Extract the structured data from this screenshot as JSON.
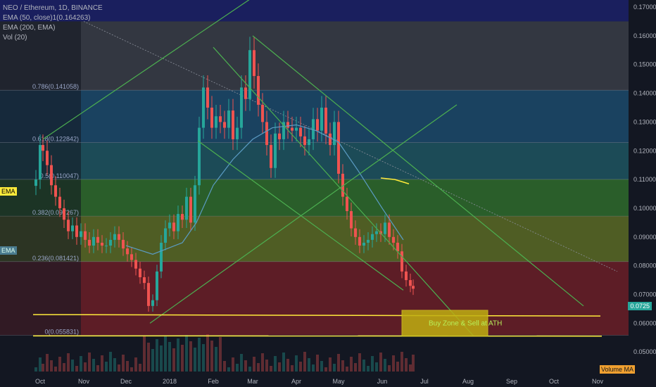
{
  "legend": {
    "symbol_line": "NEO / Ethereum, 1D, BINANCE",
    "ema50_line": "EMA (50, close)1(0.164263)",
    "ema200_line": "EMA (200, EMA)",
    "vol_line": "Vol (20)"
  },
  "left_badges": {
    "ema_yellow": "EMA",
    "ema_teal": "EMA"
  },
  "volume_ma_label": "Volume MA",
  "last_price_badge": "0.0725",
  "colors": {
    "background": "#131722",
    "up": "#26a69a",
    "down": "#ef5350",
    "channel": "#4caf50",
    "support": "#ffeb3b",
    "ema": "#5b9cc4",
    "buy_zone_fill": "#bfae12",
    "buy_zone_text": "#b8f05a",
    "fib_band_colors": [
      "#3a3d46",
      "#1c4a6b",
      "#1f5560",
      "#2f6b2c",
      "#5b6a24",
      "#6b1f27"
    ]
  },
  "chart_data": {
    "type": "candlestick",
    "title": "NEO / Ethereum, 1D, BINANCE",
    "x_tick_labels": [
      "Oct",
      "Nov",
      "Dec",
      "2018",
      "Feb",
      "Mar",
      "Apr",
      "May",
      "Jun",
      "Jul",
      "Aug",
      "Sep",
      "Oct",
      "Nov"
    ],
    "y_tick_labels": [
      "0.170000",
      "0.160000",
      "0.150000",
      "0.140000",
      "0.130000",
      "0.120000",
      "0.110000",
      "0.100000",
      "0.090000",
      "0.080000",
      "0.070000",
      "0.060000",
      "0.050000"
    ],
    "ylim": [
      0.05,
      0.17
    ],
    "fib_levels": [
      {
        "label": "0.786(0.141058)",
        "value": 0.141058
      },
      {
        "label": "0.618(0.122842)",
        "value": 0.122842
      },
      {
        "label": "0.5(0.110047)",
        "value": 0.110047
      },
      {
        "label": "0.382(0.097267)",
        "value": 0.097267
      },
      {
        "label": "0.236(0.081421)",
        "value": 0.081421
      },
      {
        "label": "0(0.055831)",
        "value": 0.055831
      }
    ],
    "fib_top": 0.165,
    "annotation": "Buy Zone & Sell at ATH",
    "buy_zone": {
      "from": "2018-06-15",
      "to": "2018-08-15",
      "low": 0.0555,
      "high": 0.0645
    },
    "support_lines": [
      {
        "from": "2017-10-01",
        "to": "2018-11-03",
        "value_start": 0.063,
        "value_end": 0.0625
      },
      {
        "from": "2017-10-01",
        "to": "2018-11-04",
        "value_start": 0.0556,
        "value_end": 0.0555
      }
    ],
    "trend_lines": [
      {
        "x1": "2017-10-03",
        "y1": 0.124,
        "x2": "2018-03-15",
        "y2": 0.178
      },
      {
        "x1": "2018-02-01",
        "y1": 0.156,
        "x2": "2018-08-05",
        "y2": 0.0555
      },
      {
        "x1": "2018-03-01",
        "y1": 0.16,
        "x2": "2018-10-22",
        "y2": 0.066
      },
      {
        "x1": "2018-01-21",
        "y1": 0.1235,
        "x2": "2018-06-16",
        "y2": 0.0715
      },
      {
        "x1": "2017-12-18",
        "y1": 0.06,
        "x2": "2018-07-24",
        "y2": 0.136
      }
    ],
    "dotted_line": {
      "x1": "2017-11-01",
      "y1": 0.165,
      "x2": "2018-11-15",
      "y2": 0.078
    },
    "yellow_curve": [
      [
        "2018-05-31",
        0.1105
      ],
      [
        "2018-06-10",
        0.11
      ],
      [
        "2018-06-20",
        0.1085
      ]
    ],
    "ema_curve": [
      [
        "2017-12-01",
        0.087
      ],
      [
        "2017-12-20",
        0.084
      ],
      [
        "2018-01-10",
        0.088
      ],
      [
        "2018-01-20",
        0.095
      ],
      [
        "2018-02-01",
        0.108
      ],
      [
        "2018-02-15",
        0.117
      ],
      [
        "2018-03-01",
        0.124
      ],
      [
        "2018-03-15",
        0.128
      ],
      [
        "2018-04-01",
        0.129
      ],
      [
        "2018-04-15",
        0.127
      ],
      [
        "2018-05-01",
        0.123
      ],
      [
        "2018-05-15",
        0.113
      ],
      [
        "2018-06-01",
        0.1
      ],
      [
        "2018-06-16",
        0.089
      ]
    ],
    "candles_close": [
      [
        "2017-09-28",
        0.11
      ],
      [
        "2017-10-01",
        0.122
      ],
      [
        "2017-10-03",
        0.12
      ],
      [
        "2017-10-06",
        0.115
      ],
      [
        "2017-10-09",
        0.108
      ],
      [
        "2017-10-12",
        0.104
      ],
      [
        "2017-10-15",
        0.1
      ],
      [
        "2017-10-18",
        0.096
      ],
      [
        "2017-10-21",
        0.092
      ],
      [
        "2017-10-24",
        0.094
      ],
      [
        "2017-10-27",
        0.09
      ],
      [
        "2017-10-30",
        0.092
      ],
      [
        "2017-11-02",
        0.089
      ],
      [
        "2017-11-05",
        0.087
      ],
      [
        "2017-11-08",
        0.09
      ],
      [
        "2017-11-11",
        0.088
      ],
      [
        "2017-11-14",
        0.087
      ],
      [
        "2017-11-17",
        0.087
      ],
      [
        "2017-11-20",
        0.089
      ],
      [
        "2017-11-23",
        0.091
      ],
      [
        "2017-11-26",
        0.089
      ],
      [
        "2017-11-29",
        0.086
      ],
      [
        "2017-12-02",
        0.084
      ],
      [
        "2017-12-05",
        0.082
      ],
      [
        "2017-12-08",
        0.079
      ],
      [
        "2017-12-11",
        0.076
      ],
      [
        "2017-12-14",
        0.074
      ],
      [
        "2017-12-17",
        0.066
      ],
      [
        "2017-12-20",
        0.068
      ],
      [
        "2017-12-23",
        0.078
      ],
      [
        "2017-12-26",
        0.088
      ],
      [
        "2017-12-29",
        0.093
      ],
      [
        "2018-01-01",
        0.095
      ],
      [
        "2018-01-04",
        0.092
      ],
      [
        "2018-01-07",
        0.098
      ],
      [
        "2018-01-10",
        0.096
      ],
      [
        "2018-01-13",
        0.104
      ],
      [
        "2018-01-16",
        0.095
      ],
      [
        "2018-01-19",
        0.108
      ],
      [
        "2018-01-22",
        0.128
      ],
      [
        "2018-01-25",
        0.142
      ],
      [
        "2018-01-28",
        0.135
      ],
      [
        "2018-01-31",
        0.128
      ],
      [
        "2018-02-03",
        0.132
      ],
      [
        "2018-02-06",
        0.13
      ],
      [
        "2018-02-09",
        0.128
      ],
      [
        "2018-02-12",
        0.134
      ],
      [
        "2018-02-15",
        0.124
      ],
      [
        "2018-02-18",
        0.128
      ],
      [
        "2018-02-21",
        0.142
      ],
      [
        "2018-02-24",
        0.138
      ],
      [
        "2018-02-27",
        0.155
      ],
      [
        "2018-03-02",
        0.146
      ],
      [
        "2018-03-05",
        0.136
      ],
      [
        "2018-03-08",
        0.13
      ],
      [
        "2018-03-11",
        0.122
      ],
      [
        "2018-03-14",
        0.114
      ],
      [
        "2018-03-17",
        0.126
      ],
      [
        "2018-03-20",
        0.124
      ],
      [
        "2018-03-23",
        0.13
      ],
      [
        "2018-03-26",
        0.128
      ],
      [
        "2018-03-29",
        0.127
      ],
      [
        "2018-04-01",
        0.128
      ],
      [
        "2018-04-04",
        0.125
      ],
      [
        "2018-04-07",
        0.122
      ],
      [
        "2018-04-10",
        0.124
      ],
      [
        "2018-04-13",
        0.131
      ],
      [
        "2018-04-16",
        0.127
      ],
      [
        "2018-04-19",
        0.135
      ],
      [
        "2018-04-22",
        0.126
      ],
      [
        "2018-04-25",
        0.122
      ],
      [
        "2018-04-28",
        0.13
      ],
      [
        "2018-05-01",
        0.112
      ],
      [
        "2018-05-04",
        0.104
      ],
      [
        "2018-05-07",
        0.099
      ],
      [
        "2018-05-10",
        0.093
      ],
      [
        "2018-05-13",
        0.09
      ],
      [
        "2018-05-16",
        0.087
      ],
      [
        "2018-05-19",
        0.088
      ],
      [
        "2018-05-22",
        0.089
      ],
      [
        "2018-05-25",
        0.091
      ],
      [
        "2018-05-28",
        0.092
      ],
      [
        "2018-05-31",
        0.091
      ],
      [
        "2018-06-03",
        0.095
      ],
      [
        "2018-06-06",
        0.09
      ],
      [
        "2018-06-09",
        0.088
      ],
      [
        "2018-06-12",
        0.085
      ],
      [
        "2018-06-15",
        0.078
      ],
      [
        "2018-06-18",
        0.075
      ],
      [
        "2018-06-21",
        0.073
      ],
      [
        "2018-06-23",
        0.072
      ]
    ]
  }
}
